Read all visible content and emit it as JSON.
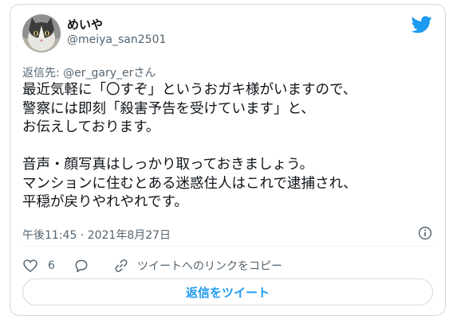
{
  "tweet": {
    "display_name": "めいや",
    "handle": "@meiya_san2501",
    "reply_to_prefix": "返信先: ",
    "reply_to_handle": "@er_gary_er",
    "reply_to_suffix": "さん",
    "text": "最近気軽に「〇すぞ」というおガキ様がいますので、\n警察には即刻「殺害予告を受けています」と、\nお伝えしております。\n\n音声・顔写真はしっかり取っておきましょう。\nマンションに住むとある迷惑住人はこれで逮捕され、\n平穏が戻りやれやれです。",
    "timestamp": "午後11:45 · 2021年8月27日"
  },
  "actions": {
    "like_count": "6",
    "copy_link_label": "ツイートへのリンクをコピー",
    "reply_button_label": "返信をツイート"
  },
  "icons": {
    "avatar": "cat-avatar",
    "logo": "twitter-bird-icon",
    "info": "info-icon",
    "like": "heart-icon",
    "reply": "speech-bubble-icon",
    "copy": "link-icon"
  },
  "colors": {
    "accent": "#1d9bf0",
    "secondary_text": "#536471",
    "border": "#cfd9de"
  }
}
